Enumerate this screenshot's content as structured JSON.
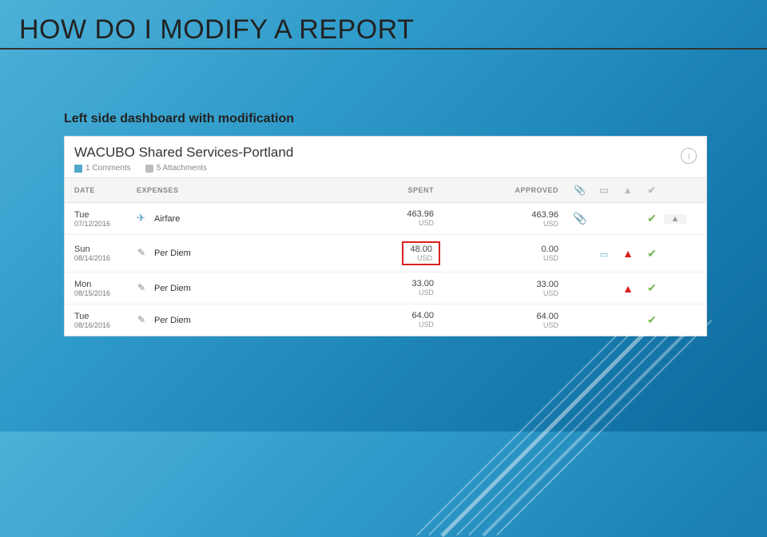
{
  "slide": {
    "title": "HOW DO I MODIFY A REPORT",
    "subtitle": "Left side dashboard with modification"
  },
  "report": {
    "title": "WACUBO Shared Services-Portland",
    "comments_count": "1 Comments",
    "attachments_count": "5 Attachments"
  },
  "columns": {
    "date": "DATE",
    "expenses": "EXPENSES",
    "spent": "SPENT",
    "approved": "APPROVED"
  },
  "rows": [
    {
      "day": "Tue",
      "date": "07/12/2016",
      "expense_type": "Airfare",
      "expense_icon": "airfare",
      "spent_amount": "463.96",
      "spent_currency": "USD",
      "approved_amount": "463.96",
      "approved_currency": "USD",
      "has_attachment": true,
      "has_comment": false,
      "has_warning": false,
      "is_checked": true,
      "highlight_spent": false,
      "show_scroll": true
    },
    {
      "day": "Sun",
      "date": "08/14/2016",
      "expense_type": "Per Diem",
      "expense_icon": "perdiem",
      "spent_amount": "48.00",
      "spent_currency": "USD",
      "approved_amount": "0.00",
      "approved_currency": "USD",
      "has_attachment": false,
      "has_comment": true,
      "has_warning": true,
      "is_checked": true,
      "highlight_spent": true,
      "show_scroll": false
    },
    {
      "day": "Mon",
      "date": "08/15/2016",
      "expense_type": "Per Diem",
      "expense_icon": "perdiem",
      "spent_amount": "33.00",
      "spent_currency": "USD",
      "approved_amount": "33.00",
      "approved_currency": "USD",
      "has_attachment": false,
      "has_comment": false,
      "has_warning": true,
      "is_checked": true,
      "highlight_spent": false,
      "show_scroll": false
    },
    {
      "day": "Tue",
      "date": "08/16/2016",
      "expense_type": "Per Diem",
      "expense_icon": "perdiem",
      "spent_amount": "64.00",
      "spent_currency": "USD",
      "approved_amount": "64.00",
      "approved_currency": "USD",
      "has_attachment": false,
      "has_comment": false,
      "has_warning": false,
      "is_checked": true,
      "highlight_spent": false,
      "show_scroll": false
    }
  ]
}
